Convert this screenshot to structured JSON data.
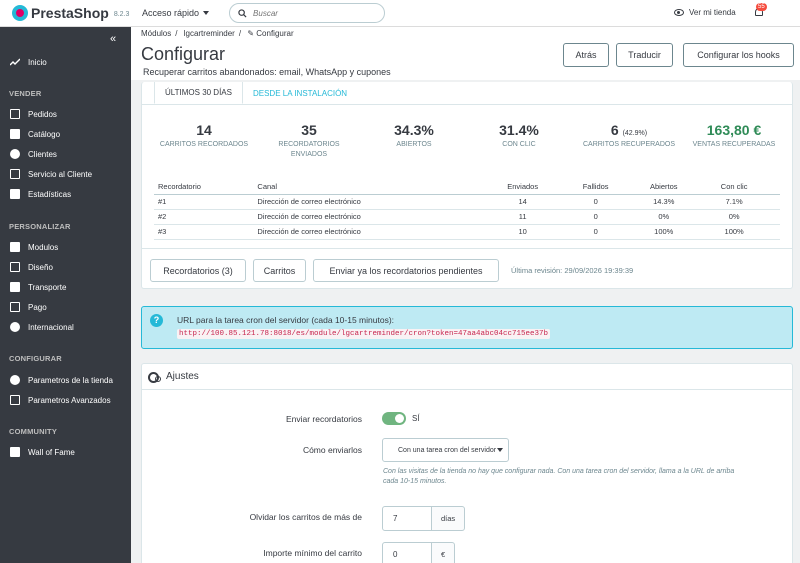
{
  "topbar": {
    "brand": "PrestaShop",
    "version": "8.2.3",
    "quick_access": "Acceso rápido",
    "search_placeholder": "Buscar",
    "view_store": "Ver mi tienda",
    "notifications_count": "55"
  },
  "sidebar": {
    "items_top": [
      {
        "label": "Inicio",
        "icon": "trend-icon"
      }
    ],
    "sections": [
      {
        "title": "VENDER",
        "items": [
          {
            "label": "Pedidos",
            "icon": "inbox-icon"
          },
          {
            "label": "Catálogo",
            "icon": "store-icon"
          },
          {
            "label": "Clientes",
            "icon": "user-icon"
          },
          {
            "label": "Servicio al Cliente",
            "icon": "chat-icon"
          },
          {
            "label": "Estadísticas",
            "icon": "bar-chart-icon"
          }
        ]
      },
      {
        "title": "PERSONALIZAR",
        "items": [
          {
            "label": "Modulos",
            "icon": "puzzle-icon"
          },
          {
            "label": "Diseño",
            "icon": "monitor-icon"
          },
          {
            "label": "Transporte",
            "icon": "truck-icon"
          },
          {
            "label": "Pago",
            "icon": "card-icon"
          },
          {
            "label": "Internacional",
            "icon": "globe-icon"
          }
        ]
      },
      {
        "title": "CONFIGURAR",
        "items": [
          {
            "label": "Parametros de la tienda",
            "icon": "gear-icon"
          },
          {
            "label": "Parametros Avanzados",
            "icon": "settings-icon"
          }
        ]
      },
      {
        "title": "COMMUNITY",
        "items": [
          {
            "label": "Wall of Fame",
            "icon": "group-icon"
          }
        ]
      }
    ]
  },
  "header": {
    "breadcrumb": [
      "Módulos",
      "lgcartreminder",
      "Configurar"
    ],
    "title": "Configurar",
    "subtitle": "Recuperar carritos abandonados: email, WhatsApp y cupones",
    "buttons": {
      "back": "Atrás",
      "translate": "Traducir",
      "hooks": "Configurar los hooks"
    }
  },
  "stats": {
    "tabs": [
      "ÚLTIMOS 30 DÍAS",
      "DESDE LA INSTALACIÓN"
    ],
    "kpis": [
      {
        "value": "14",
        "label": "CARRITOS RECORDADOS"
      },
      {
        "value": "35",
        "label": "RECORDATORIOS ENVIADOS"
      },
      {
        "value": "34.3%",
        "label": "ABIERTOS"
      },
      {
        "value": "31.4%",
        "label": "CON CLIC"
      },
      {
        "value": "6",
        "extra": "(42.9%)",
        "label": "CARRITOS RECUPERADOS"
      },
      {
        "value": "163,80 €",
        "label": "VENTAS RECUPERADAS"
      }
    ],
    "table": {
      "headers": [
        "Recordatorio",
        "Canal",
        "Enviados",
        "Fallidos",
        "Abiertos",
        "Con clic"
      ],
      "rows": [
        [
          "#1",
          "Dirección de correo electrónico",
          "14",
          "0",
          "14.3%",
          "7.1%"
        ],
        [
          "#2",
          "Dirección de correo electrónico",
          "11",
          "0",
          "0%",
          "0%"
        ],
        [
          "#3",
          "Dirección de correo electrónico",
          "10",
          "0",
          "100%",
          "100%"
        ]
      ]
    },
    "buttons": {
      "reminders": "Recordatorios (3)",
      "carts": "Carritos",
      "send_pending": "Enviar ya los recordatorios pendientes"
    },
    "last_revision": "Última revisión: 29/09/2026 19:39:39"
  },
  "alert": {
    "text": "URL para la tarea cron del servidor (cada 10-15 minutos):",
    "url": "http://100.85.121.78:8018/es/module/lgcartreminder/cron?token=47aa4abc04cc715ee37b"
  },
  "settings": {
    "title": "Ajustes",
    "send_label": "Enviar recordatorios",
    "send_value": "SÍ",
    "how_label": "Cómo enviarlos",
    "how_value": "Con una tarea cron del servidor",
    "how_help": "Con las visitas de la tienda no hay que configurar nada. Con una tarea cron del servidor, llama a la URL de arriba cada 10-15 minutos.",
    "forget_label": "Olvidar los carritos de más de",
    "forget_value": "7",
    "forget_unit": "días",
    "min_label": "Importe mínimo del carrito",
    "min_value": "0",
    "min_unit": "€"
  }
}
